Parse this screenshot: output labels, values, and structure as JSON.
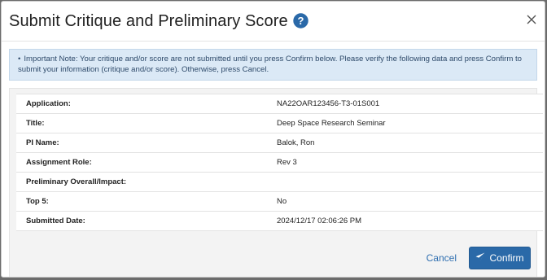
{
  "dialog": {
    "title": "Submit Critique and Preliminary Score",
    "help_icon": "question-circle-icon",
    "close_icon": "close-icon"
  },
  "alert": {
    "text": "Important Note: Your critique and/or score are not submitted until you press Confirm below. Please verify the following data and press Confirm to submit your information (critique and/or score). Otherwise, press Cancel."
  },
  "details": [
    {
      "label": "Application:",
      "value": "NA22OAR123456-T3-01S001"
    },
    {
      "label": "Title:",
      "value": "Deep Space Research Seminar"
    },
    {
      "label": "PI Name:",
      "value": "Balok, Ron"
    },
    {
      "label": "Assignment Role:",
      "value": "Rev 3"
    },
    {
      "label": "Preliminary Overall/Impact:",
      "value": ""
    },
    {
      "label": "Top 5:",
      "value": "No"
    },
    {
      "label": "Submitted Date:",
      "value": "2024/12/17 02:06:26 PM"
    }
  ],
  "footer": {
    "cancel_label": "Cancel",
    "confirm_label": "Confirm",
    "confirm_icon": "paper-plane-icon"
  },
  "colors": {
    "accent": "#2a69a8",
    "alert_bg": "#dbe9f6",
    "link": "#2f6fb0"
  }
}
